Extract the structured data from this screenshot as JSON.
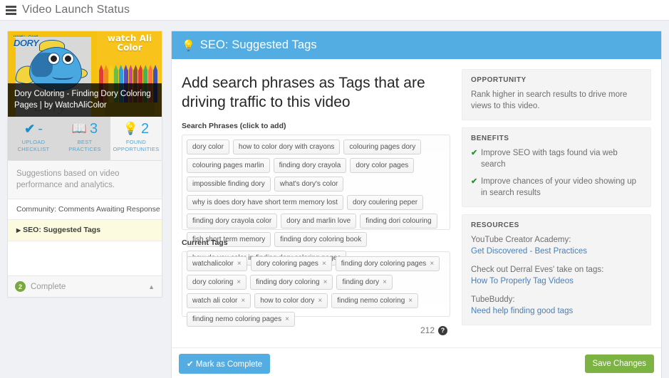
{
  "topbar": {
    "icon": "list-icon",
    "title": "Video Launch Status"
  },
  "sidebar": {
    "thumbnail": {
      "brand_logo": "DORY",
      "brand_logo_sub": "DISNEY · PIXAR",
      "overlay_text_right": "watch Ali Color",
      "watermark": "Dory",
      "caption": "Dory Coloring - Finding Dory Coloring Pages | by WatchAliColor"
    },
    "stats": [
      {
        "icon": "check-icon",
        "value": "-",
        "label_line1": "UPLOAD",
        "label_line2": "CHECKLIST",
        "active": false
      },
      {
        "icon": "book-icon",
        "value": "3",
        "label_line1": "BEST",
        "label_line2": "PRACTICES",
        "active": false
      },
      {
        "icon": "lightbulb-icon",
        "value": "2",
        "label_line1": "FOUND",
        "label_line2": "OPPORTUNITIES",
        "active": true
      }
    ],
    "blurb": "Suggestions based on video performance and analytics.",
    "items": [
      {
        "label": "Community: Comments Awaiting Response",
        "selected": false
      },
      {
        "label": "SEO: Suggested Tags",
        "selected": true
      }
    ],
    "footer": {
      "count": "2",
      "label": "Complete",
      "collapse_icon": "caret-up-icon"
    }
  },
  "main": {
    "header": {
      "icon": "lightbulb-icon",
      "title": "SEO: Suggested Tags"
    },
    "headline": "Add search phrases as Tags that are driving traffic to this video",
    "search_phrases_label": "Search Phrases (click to add)",
    "search_phrases": [
      "dory color",
      "how to color dory with crayons",
      "colouring pages dory",
      "colouring pages marlin",
      "finding dory crayola",
      "dory color pages",
      "impossible finding dory",
      "what's dory's color",
      "why is does dory have short term memory lost",
      "dory coulering peper",
      "finding dory crayola color",
      "dory and marlin love",
      "finding dori colouring",
      "fish short term memory",
      "finding dory coloring book",
      "how do you color in finding dory coloring pages"
    ],
    "current_tags_label": "Current Tags",
    "current_tags": [
      "watchalicolor",
      "dory coloring pages",
      "finding dory coloring pages",
      "dory coloring",
      "finding dory coloring",
      "finding dory",
      "watch ali color",
      "how to color dory",
      "finding nemo coloring",
      "finding nemo coloring pages"
    ],
    "remove_symbol": "×",
    "char_counter": "212",
    "help_icon": "question-mark-icon",
    "footer": {
      "mark_complete_label": "Mark as Complete",
      "mark_complete_icon": "check-icon",
      "save_label": "Save Changes"
    }
  },
  "info_panels": {
    "opportunity": {
      "title": "OPPORTUNITY",
      "text": "Rank higher in search results to drive more views to this video."
    },
    "benefits": {
      "title": "BENEFITS",
      "items": [
        "Improve SEO with tags found via web search",
        "Improve chances of your video showing up in search results"
      ]
    },
    "resources": {
      "title": "RESOURCES",
      "groups": [
        {
          "text": "YouTube Creator Academy:",
          "link": "Get Discovered - Best Practices"
        },
        {
          "text": "Check out Derral Eves' take on tags:",
          "link": "How To Properly Tag Videos"
        },
        {
          "text": "TubeBuddy:",
          "link": "Need help finding good tags"
        }
      ]
    }
  },
  "colors": {
    "accent_blue": "#54ade2",
    "save_green": "#7cb342",
    "selected_row": "#fcfbe0",
    "complete_badge": "#79a840",
    "link_blue": "#4b7fb5"
  }
}
